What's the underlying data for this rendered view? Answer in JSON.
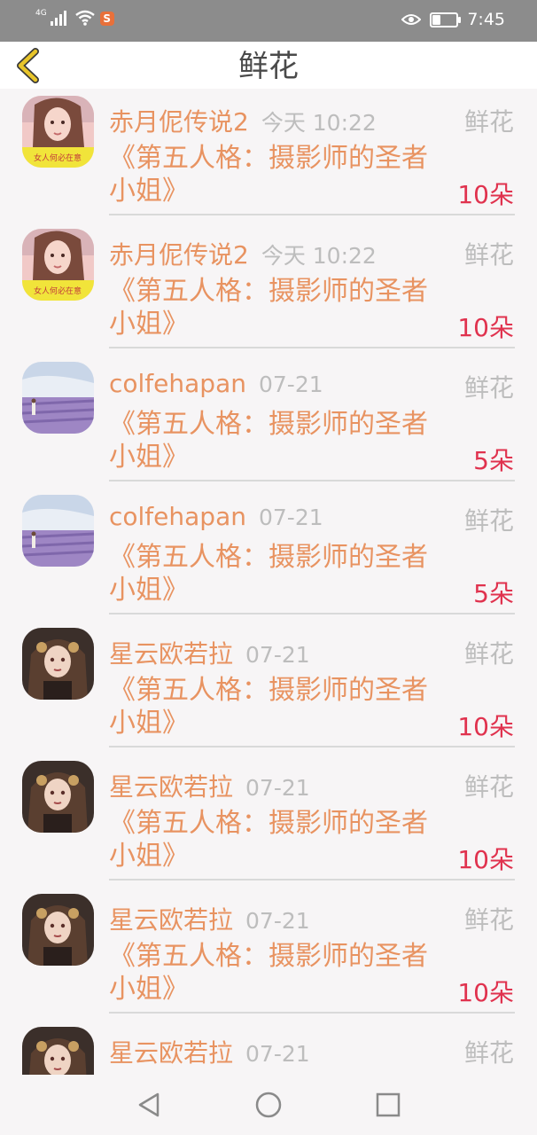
{
  "status_bar": {
    "network": "4G",
    "time": "7:45",
    "icons": [
      "signal-icon",
      "wifi-icon",
      "app-notification-icon",
      "eye-icon",
      "battery-icon"
    ]
  },
  "header": {
    "title": "鲜花",
    "back_icon": "chevron-left-icon"
  },
  "records": [
    {
      "name": "赤月伲传说2",
      "time": "今天 10:22",
      "type": "鲜花",
      "book": "《第五人格：摄影师的圣者小姐》",
      "count": "10朵",
      "avatar": "avatar-girl-photo"
    },
    {
      "name": "赤月伲传说2",
      "time": "今天 10:22",
      "type": "鲜花",
      "book": "《第五人格：摄影师的圣者小姐》",
      "count": "10朵",
      "avatar": "avatar-girl-photo"
    },
    {
      "name": "colfehapan",
      "time": "07-21",
      "type": "鲜花",
      "book": "《第五人格：摄影师的圣者小姐》",
      "count": "5朵",
      "avatar": "avatar-lavender-field"
    },
    {
      "name": "colfehapan",
      "time": "07-21",
      "type": "鲜花",
      "book": "《第五人格：摄影师的圣者小姐》",
      "count": "5朵",
      "avatar": "avatar-lavender-field"
    },
    {
      "name": "星云欧若拉",
      "time": "07-21",
      "type": "鲜花",
      "book": "《第五人格：摄影师的圣者小姐》",
      "count": "10朵",
      "avatar": "avatar-anime-lady"
    },
    {
      "name": "星云欧若拉",
      "time": "07-21",
      "type": "鲜花",
      "book": "《第五人格：摄影师的圣者小姐》",
      "count": "10朵",
      "avatar": "avatar-anime-lady"
    },
    {
      "name": "星云欧若拉",
      "time": "07-21",
      "type": "鲜花",
      "book": "《第五人格：摄影师的圣者小姐》",
      "count": "10朵",
      "avatar": "avatar-anime-lady"
    },
    {
      "name": "星云欧若拉",
      "time": "07-21",
      "type": "鲜花",
      "book": "",
      "count": "",
      "avatar": "avatar-anime-lady"
    }
  ],
  "avatar_texts": {
    "girl_caption": "女人何必在意"
  },
  "nav_bar": {
    "icons": [
      "back-triangle-icon",
      "home-circle-icon",
      "recents-square-icon"
    ]
  },
  "colors": {
    "accent": "#e89361",
    "count": "#e0324e",
    "muted": "#bdbdbd",
    "back_arrow": "#e8c52a"
  }
}
